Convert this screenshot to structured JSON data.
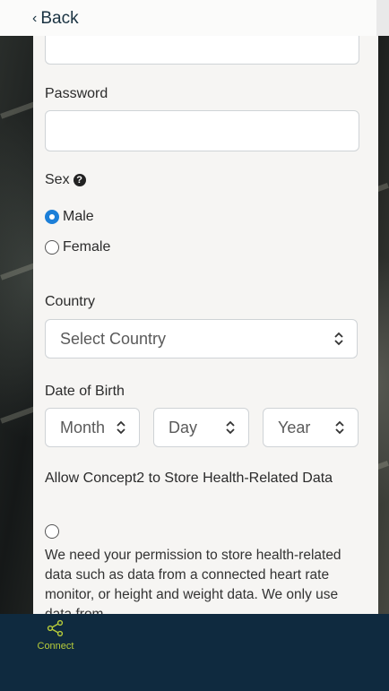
{
  "nav": {
    "back_label": "Back"
  },
  "form": {
    "password_label": "Password",
    "sex_label": "Sex",
    "sex_options": {
      "male": "Male",
      "female": "Female",
      "selected": "Male"
    },
    "country_label": "Country",
    "country_select": "Select Country",
    "dob_label": "Date of Birth",
    "dob_month": "Month",
    "dob_day": "Day",
    "dob_year": "Year",
    "health_heading": "Allow Concept2 to Store Health-Related Data",
    "health_text": "We need your permission to store health-related data such as data from a connected heart rate monitor, or height and weight data. We only use data from"
  },
  "footer": {
    "connect_label": "Connect"
  },
  "colors": {
    "accent": "#1c7fd8",
    "footer_bg": "#0f2a3f",
    "connect": "#b7cc3a"
  }
}
